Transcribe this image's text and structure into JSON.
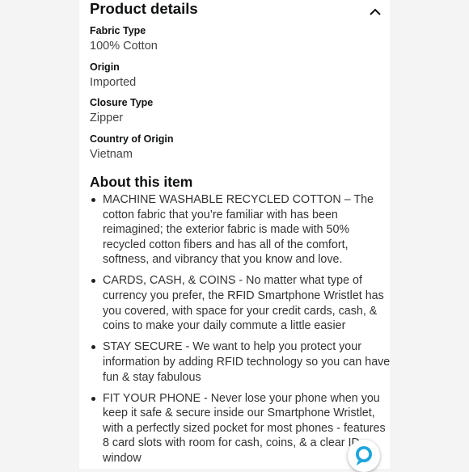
{
  "product_details": {
    "title": "Product details",
    "items": [
      {
        "label": "Fabric Type",
        "value": "100% Cotton"
      },
      {
        "label": "Origin",
        "value": "Imported"
      },
      {
        "label": "Closure Type",
        "value": "Zipper"
      },
      {
        "label": "Country of Origin",
        "value": "Vietnam"
      }
    ]
  },
  "about": {
    "title": "About this item",
    "bullets": [
      "MACHINE WASHABLE RECYCLED COTTON – The cotton fabric that you’re familiar with has been reimagined; the exterior fabric is made with 50% recycled cotton fibers and has all of the comfort, softness, and vibrancy that you know and love.",
      "CARDS, CASH, & COINS - No matter what type of currency you prefer, the RFID Smartphone Wristlet has you covered, with space for your credit cards, cash, & coins to make your daily commute a little easier",
      "STAY SECURE - We want to help you protect your information by adding RFID technology so you can have fun & stay fabulous",
      "FIT YOUR PHONE - Never lose your phone when you keep it safe & secure inside our Smartphone Wristlet, with a perfectly sized pocket for most phones - features 8 card slots with room for cash, coins, & a clear ID window"
    ]
  },
  "icons": {
    "collapse": "chevron-up-icon",
    "assistant": "alexa-icon"
  },
  "colors": {
    "background": "#f4f4f4",
    "panel": "#ffffff",
    "text": "#0f1111",
    "alexa_blue": "#1ea5dc"
  }
}
